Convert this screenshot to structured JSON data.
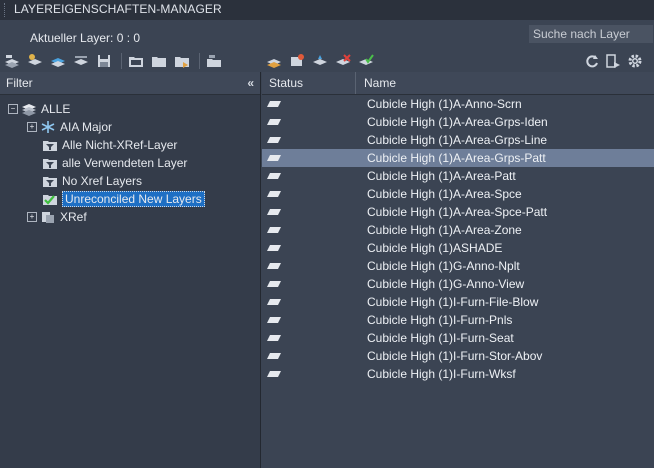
{
  "window": {
    "title": "LAYEREIGENSCHAFTEN-MANAGER"
  },
  "current_layer": "Aktueller Layer: 0 : 0",
  "search": {
    "placeholder": "Suche nach Layer"
  },
  "filter_panel": {
    "header": "Filter",
    "collapse_glyph": "«",
    "tree": [
      {
        "label": "ALLE",
        "icon": "layer-stack-icon",
        "expander": "−"
      },
      {
        "label": "AIA Major",
        "icon": "snowflake-icon",
        "expander": "+"
      },
      {
        "label": "Alle Nicht-XRef-Layer",
        "icon": "layer-filter-icon"
      },
      {
        "label": "alle Verwendeten Layer",
        "icon": "layer-filter-icon"
      },
      {
        "label": "No Xref Layers",
        "icon": "layer-filter-icon"
      },
      {
        "label": "Unreconciled New Layers",
        "icon": "layer-filter-check-icon"
      },
      {
        "label": "XRef",
        "icon": "xref-icon",
        "expander": "+"
      }
    ]
  },
  "columns": {
    "status": "Status",
    "name": "Name"
  },
  "layers": [
    "Cubicle High (1)A-Anno-Scrn",
    "Cubicle High (1)A-Area-Grps-Iden",
    "Cubicle High (1)A-Area-Grps-Line",
    "Cubicle High (1)A-Area-Grps-Patt",
    "Cubicle High (1)A-Area-Patt",
    "Cubicle High (1)A-Area-Spce",
    "Cubicle High (1)A-Area-Spce-Patt",
    "Cubicle High (1)A-Area-Zone",
    "Cubicle High (1)ASHADE",
    "Cubicle High (1)G-Anno-Nplt",
    "Cubicle High (1)G-Anno-View",
    "Cubicle High (1)I-Furn-File-Blow",
    "Cubicle High (1)I-Furn-Pnls",
    "Cubicle High (1)I-Furn-Seat",
    "Cubicle High (1)I-Furn-Stor-Abov",
    "Cubicle High (1)I-Furn-Wksf"
  ],
  "selected_row_index": 3,
  "colors": {
    "accent": "#1e6fc4",
    "selected_row": "#6e7e99",
    "background": "#3b4453"
  }
}
